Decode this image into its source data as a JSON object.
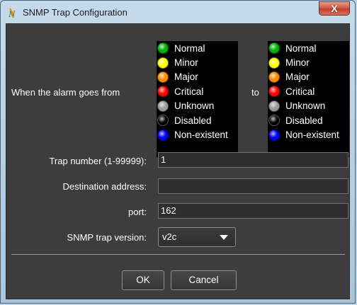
{
  "window": {
    "title": "SNMP Trap Configuration",
    "close_label": "X"
  },
  "alarm": {
    "label_from": "When the alarm goes from",
    "label_to": "to",
    "states": [
      {
        "label": "Normal",
        "color": "#00b000"
      },
      {
        "label": "Minor",
        "color": "#ffff00"
      },
      {
        "label": "Major",
        "color": "#ff8a00"
      },
      {
        "label": "Critical",
        "color": "#ff0000"
      },
      {
        "label": "Unknown",
        "color": "#9a9a9a"
      },
      {
        "label": "Disabled",
        "color": "#000000"
      },
      {
        "label": "Non-existent",
        "color": "#0000ff"
      }
    ]
  },
  "form": {
    "trap_number_label": "Trap number (1-99999):",
    "trap_number_value": "1",
    "destination_label": "Destination address:",
    "destination_value": "",
    "port_label": "port:",
    "port_value": "162",
    "version_label": "SNMP trap version:",
    "version_value": "v2c"
  },
  "buttons": {
    "ok": "OK",
    "cancel": "Cancel"
  }
}
